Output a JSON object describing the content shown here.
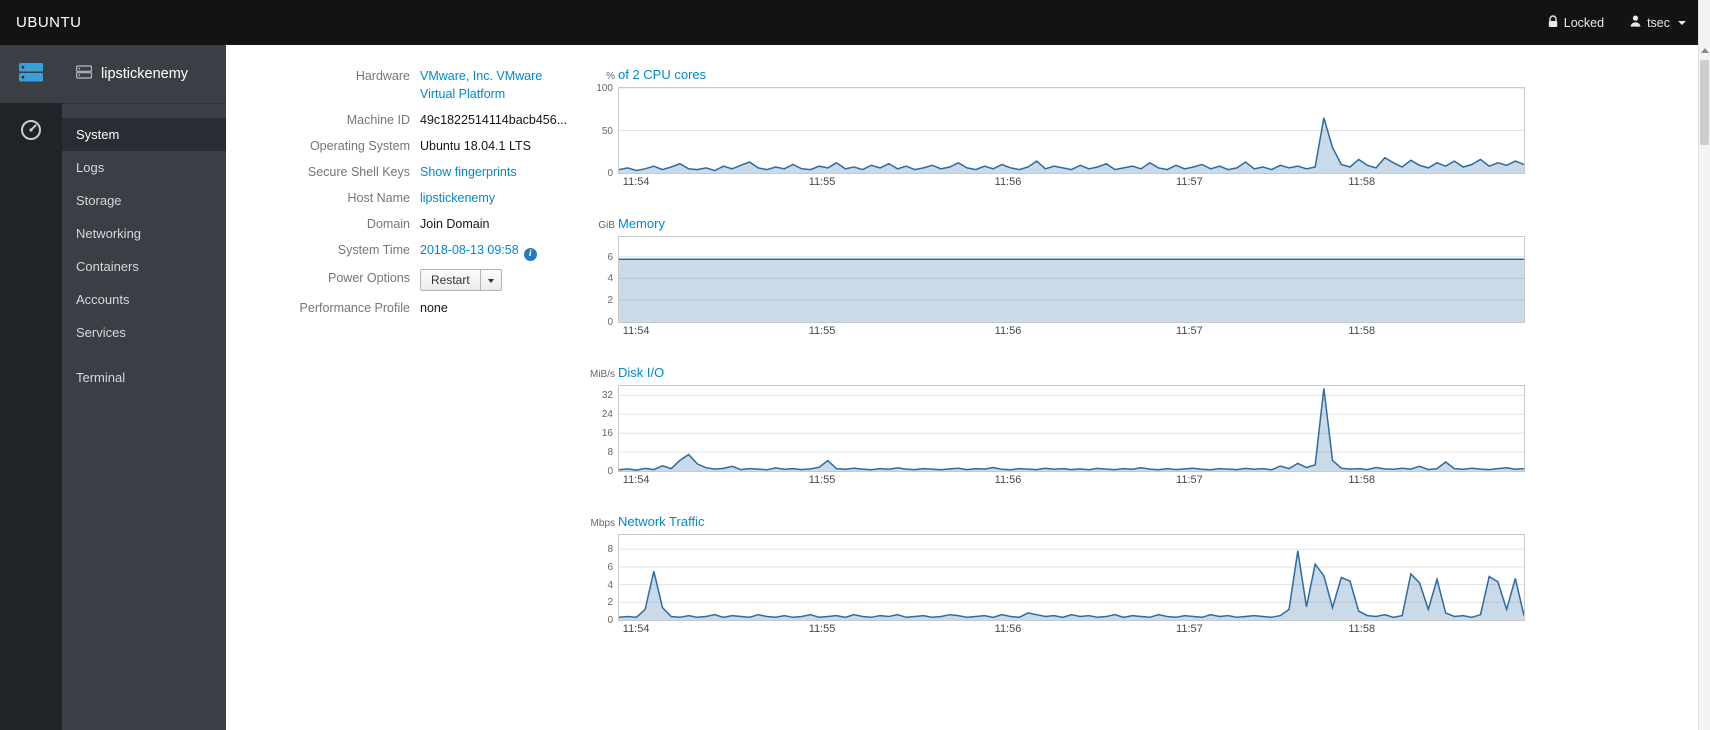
{
  "topbar": {
    "brand": "UBUNTU",
    "locked_label": "Locked",
    "user_label": "tsec"
  },
  "sidebar": {
    "hostname": "lipstickenemy",
    "items": [
      {
        "label": "System"
      },
      {
        "label": "Logs"
      },
      {
        "label": "Storage"
      },
      {
        "label": "Networking"
      },
      {
        "label": "Containers"
      },
      {
        "label": "Accounts"
      },
      {
        "label": "Services"
      },
      {
        "label": "Terminal"
      }
    ]
  },
  "system_info": {
    "hardware": {
      "label": "Hardware",
      "value": "VMware, Inc. VMware Virtual Platform"
    },
    "machine_id": {
      "label": "Machine ID",
      "value": "49c1822514114bacb456..."
    },
    "os": {
      "label": "Operating System",
      "value": "Ubuntu 18.04.1 LTS"
    },
    "ssh_keys": {
      "label": "Secure Shell Keys",
      "value": "Show fingerprints"
    },
    "host_name": {
      "label": "Host Name",
      "value": "lipstickenemy"
    },
    "domain": {
      "label": "Domain",
      "value": "Join Domain"
    },
    "system_time": {
      "label": "System Time",
      "value": "2018-08-13 09:58"
    },
    "power_options": {
      "label": "Power Options",
      "value": "Restart"
    },
    "performance_profile": {
      "label": "Performance Profile",
      "value": "none"
    }
  },
  "colors": {
    "accent_blue": "#0088ce",
    "chart_line": "#2b6ca3",
    "topbar_bg": "#131313",
    "sidebar_bg": "#393f45"
  },
  "chart_data": [
    {
      "type": "area",
      "unit": "%",
      "title": "of 2 CPU cores",
      "ylim": [
        0,
        100
      ],
      "yticks": [
        0,
        50,
        100
      ],
      "x_labels": [
        "11:54",
        "11:55",
        "11:56",
        "11:57",
        "11:58"
      ],
      "values": [
        4,
        6,
        3,
        5,
        8,
        4,
        7,
        11,
        5,
        4,
        6,
        3,
        8,
        5,
        9,
        13,
        6,
        4,
        7,
        5,
        10,
        5,
        4,
        8,
        6,
        12,
        5,
        7,
        4,
        9,
        6,
        11,
        5,
        8,
        4,
        6,
        9,
        5,
        7,
        12,
        6,
        4,
        8,
        5,
        10,
        6,
        4,
        7,
        14,
        5,
        8,
        6,
        4,
        9,
        5,
        7,
        11,
        4,
        6,
        8,
        5,
        12,
        6,
        4,
        9,
        5,
        7,
        10,
        5,
        8,
        4,
        6,
        13,
        5,
        7,
        4,
        9,
        6,
        8,
        5,
        7,
        65,
        30,
        10,
        7,
        16,
        9,
        6,
        18,
        12,
        7,
        15,
        9,
        6,
        12,
        8,
        14,
        7,
        10,
        16,
        8,
        12,
        9,
        14,
        10
      ]
    },
    {
      "type": "area",
      "unit": "GiB",
      "title": "Memory",
      "ylim": [
        0,
        7.8
      ],
      "yticks": [
        0,
        2,
        4,
        6
      ],
      "x_labels": [
        "11:54",
        "11:55",
        "11:56",
        "11:57",
        "11:58"
      ],
      "values": [
        5.75,
        5.75,
        5.75,
        5.75,
        5.75,
        5.75,
        5.75,
        5.75,
        5.75,
        5.75,
        5.75,
        5.75,
        5.75,
        5.75,
        5.75,
        5.75,
        5.75,
        5.75,
        5.75,
        5.75,
        5.75
      ]
    },
    {
      "type": "area",
      "unit": "MiB/s",
      "title": "Disk I/O",
      "ylim": [
        0,
        36
      ],
      "yticks": [
        0,
        8,
        16,
        24,
        32
      ],
      "x_labels": [
        "11:54",
        "11:55",
        "11:56",
        "11:57",
        "11:58"
      ],
      "values": [
        0.5,
        0.9,
        0.4,
        1.1,
        0.6,
        2.2,
        1.0,
        4.5,
        7,
        3,
        1.4,
        0.8,
        1.1,
        2.0,
        0.6,
        1.0,
        0.8,
        0.5,
        1.3,
        0.7,
        1.0,
        0.6,
        0.9,
        1.6,
        4.4,
        1.0,
        0.7,
        1.2,
        0.8,
        0.5,
        1.0,
        0.7,
        1.3,
        0.8,
        0.6,
        1.0,
        0.8,
        0.5,
        0.9,
        1.2,
        0.6,
        1.0,
        0.8,
        1.5,
        0.7,
        0.5,
        1.0,
        0.8,
        0.6,
        1.2,
        0.7,
        1.0,
        0.6,
        0.9,
        0.5,
        1.1,
        0.8,
        0.6,
        1.0,
        0.7,
        1.4,
        0.8,
        0.5,
        1.0,
        0.6,
        0.9,
        1.2,
        0.7,
        0.5,
        1.0,
        0.8,
        0.6,
        1.1,
        0.7,
        1.0,
        0.5,
        2.1,
        1.0,
        3.2,
        1.5,
        2.6,
        35,
        4.5,
        1.2,
        0.8,
        1.0,
        0.6,
        1.5,
        0.9,
        0.7,
        1.2,
        0.8,
        2.0,
        0.6,
        1.0,
        3.8,
        1.0,
        0.7,
        1.2,
        0.8,
        0.6,
        1.0,
        1.4,
        0.7,
        1.0
      ]
    },
    {
      "type": "area",
      "unit": "Mbps",
      "title": "Network Traffic",
      "ylim": [
        0,
        9.6
      ],
      "yticks": [
        0,
        2,
        4,
        6,
        8
      ],
      "x_labels": [
        "11:54",
        "11:55",
        "11:56",
        "11:57",
        "11:58"
      ],
      "values": [
        0.3,
        0.4,
        0.3,
        1.2,
        5.5,
        1.4,
        0.4,
        0.3,
        0.5,
        0.3,
        0.4,
        0.6,
        0.3,
        0.5,
        0.4,
        0.3,
        0.6,
        0.4,
        0.3,
        0.5,
        0.3,
        0.4,
        0.6,
        0.3,
        0.4,
        0.5,
        0.3,
        0.6,
        0.4,
        0.3,
        0.5,
        0.4,
        0.6,
        0.3,
        0.4,
        0.5,
        0.3,
        0.4,
        0.6,
        0.5,
        0.3,
        0.4,
        0.5,
        0.3,
        0.6,
        0.4,
        0.3,
        0.8,
        0.6,
        0.4,
        0.5,
        0.3,
        0.6,
        0.4,
        0.5,
        0.3,
        0.4,
        0.6,
        0.3,
        0.5,
        0.4,
        0.3,
        0.6,
        0.4,
        0.3,
        0.5,
        0.4,
        0.3,
        0.6,
        0.4,
        0.5,
        0.3,
        0.4,
        0.5,
        0.4,
        0.3,
        0.5,
        1.2,
        7.8,
        1.5,
        6.3,
        5.0,
        1.4,
        4.8,
        4.4,
        1.0,
        0.5,
        0.4,
        0.6,
        0.3,
        0.5,
        5.2,
        4.2,
        1.2,
        4.6,
        0.8,
        0.4,
        0.5,
        0.3,
        0.6,
        4.9,
        4.3,
        1.2,
        4.7,
        0.5
      ]
    }
  ]
}
